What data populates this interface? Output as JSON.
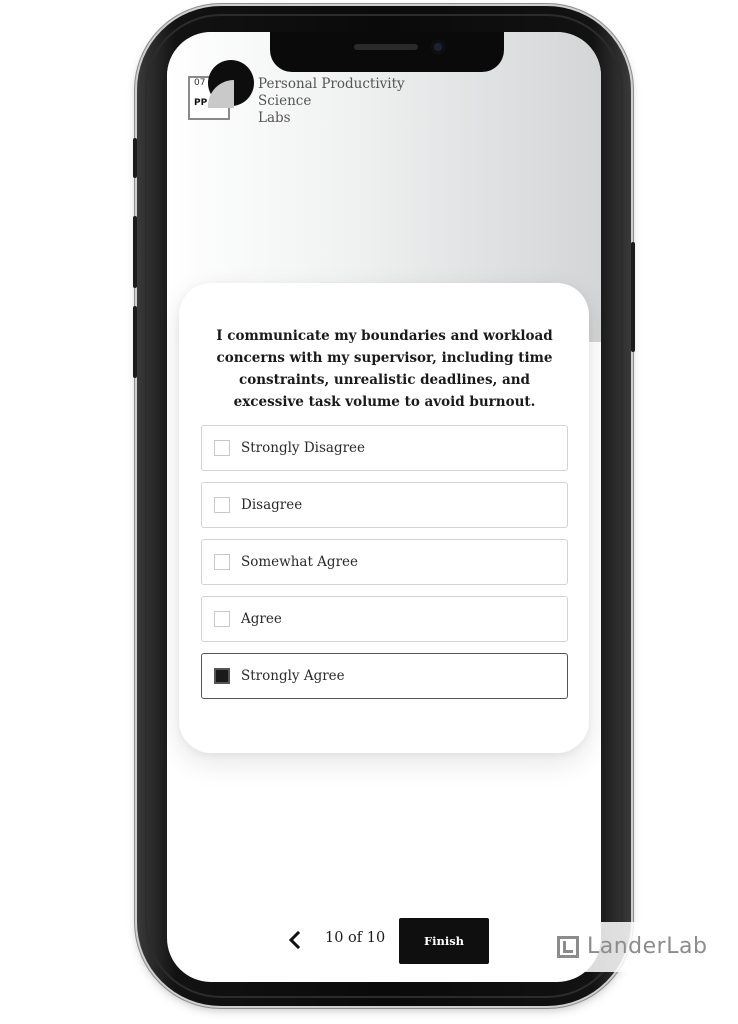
{
  "logo": {
    "number": "07",
    "abbreviation": "PP",
    "brand_lines": [
      "Personal Productivity",
      "Science",
      "Labs"
    ]
  },
  "question": {
    "text": "I communicate my boundaries and workload concerns with my supervisor, including time constraints, unrealistic deadlines, and excessive task volume to avoid burnout."
  },
  "options": [
    {
      "label": "Strongly Disagree",
      "selected": false
    },
    {
      "label": "Disagree",
      "selected": false
    },
    {
      "label": "Somewhat Agree",
      "selected": false
    },
    {
      "label": "Agree",
      "selected": false
    },
    {
      "label": "Strongly Agree",
      "selected": true
    }
  ],
  "nav": {
    "back_icon": "chevron-left-icon",
    "progress": "10 of 10",
    "finish_label": "Finish"
  },
  "watermark": {
    "text": "LanderLab"
  }
}
